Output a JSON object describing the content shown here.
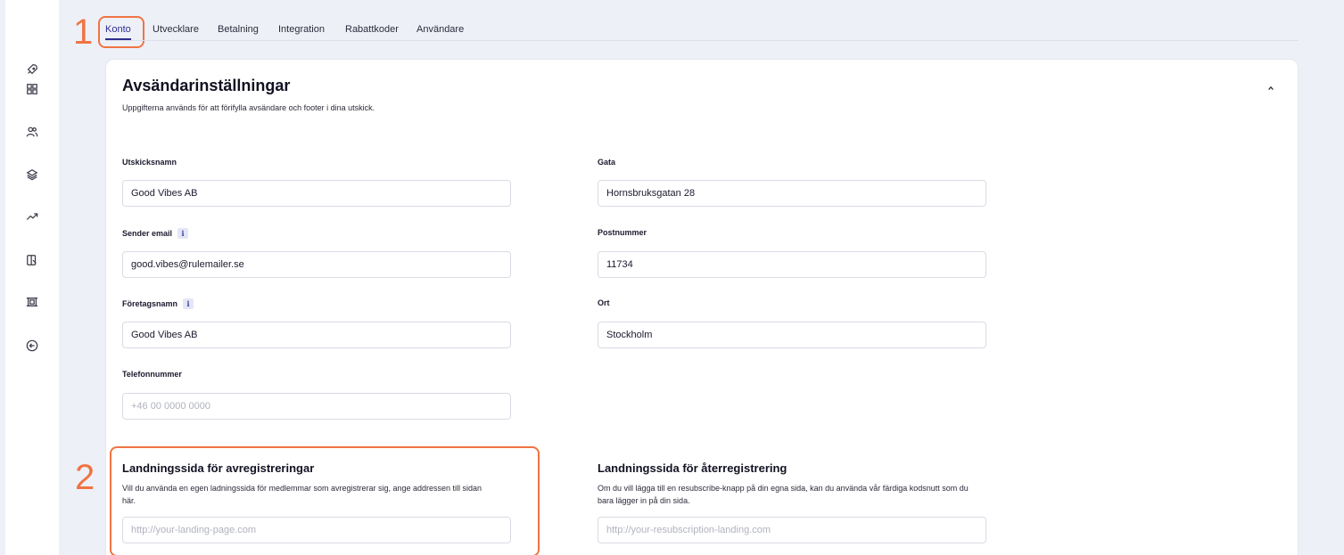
{
  "annotations": {
    "num1": "1",
    "num2": "2"
  },
  "sidebar": {
    "icons": [
      "rocket-icon",
      "grid-icon",
      "users-icon",
      "layers-icon",
      "trend-icon",
      "book-icon",
      "frame-icon",
      "back-arrow-icon"
    ]
  },
  "tabs": [
    {
      "label": "Konto",
      "active": true
    },
    {
      "label": "Utvecklare"
    },
    {
      "label": "Betalning"
    },
    {
      "label": "Integration"
    },
    {
      "label": "Rabattkoder"
    },
    {
      "label": "Användare"
    }
  ],
  "card": {
    "title": "Avsändarinställningar",
    "subtitle": "Uppgifterna används för att förifylla avsändare och footer i dina utskick."
  },
  "fields": {
    "utskicksnamn": {
      "label": "Utskicksnamn",
      "value": "Good Vibes AB"
    },
    "sender_email": {
      "label": "Sender email",
      "value": "good.vibes@rulemailer.se"
    },
    "foretagsnamn": {
      "label": "Företagsnamn",
      "value": "Good Vibes AB"
    },
    "telefonnummer": {
      "label": "Telefonnummer",
      "value": "",
      "placeholder": "+46 00 0000 0000"
    },
    "gata": {
      "label": "Gata",
      "value": "Hornsbruksgatan 28"
    },
    "postnummer": {
      "label": "Postnummer",
      "value": "11734"
    },
    "ort": {
      "label": "Ort",
      "value": "Stockholm"
    }
  },
  "unsubscribe": {
    "title": "Landningssida för avregistreringar",
    "description": "Vill du använda en egen ladningssida för medlemmar som avregistrerar sig, ange addressen till sidan här.",
    "placeholder": "http://your-landing-page.com"
  },
  "resubscribe": {
    "title": "Landningssida för återregistrering",
    "description": "Om du vill lägga till en resubscribe-knapp på din egna sida, kan du använda vår färdiga kodsnutt som du bara lägger in på din sida.",
    "placeholder": "http://your-resubscription-landing.com"
  },
  "info_glyph": "i",
  "colors": {
    "accent": "#2d2d8f",
    "annotation": "#f07443",
    "background": "#eef0f8"
  }
}
